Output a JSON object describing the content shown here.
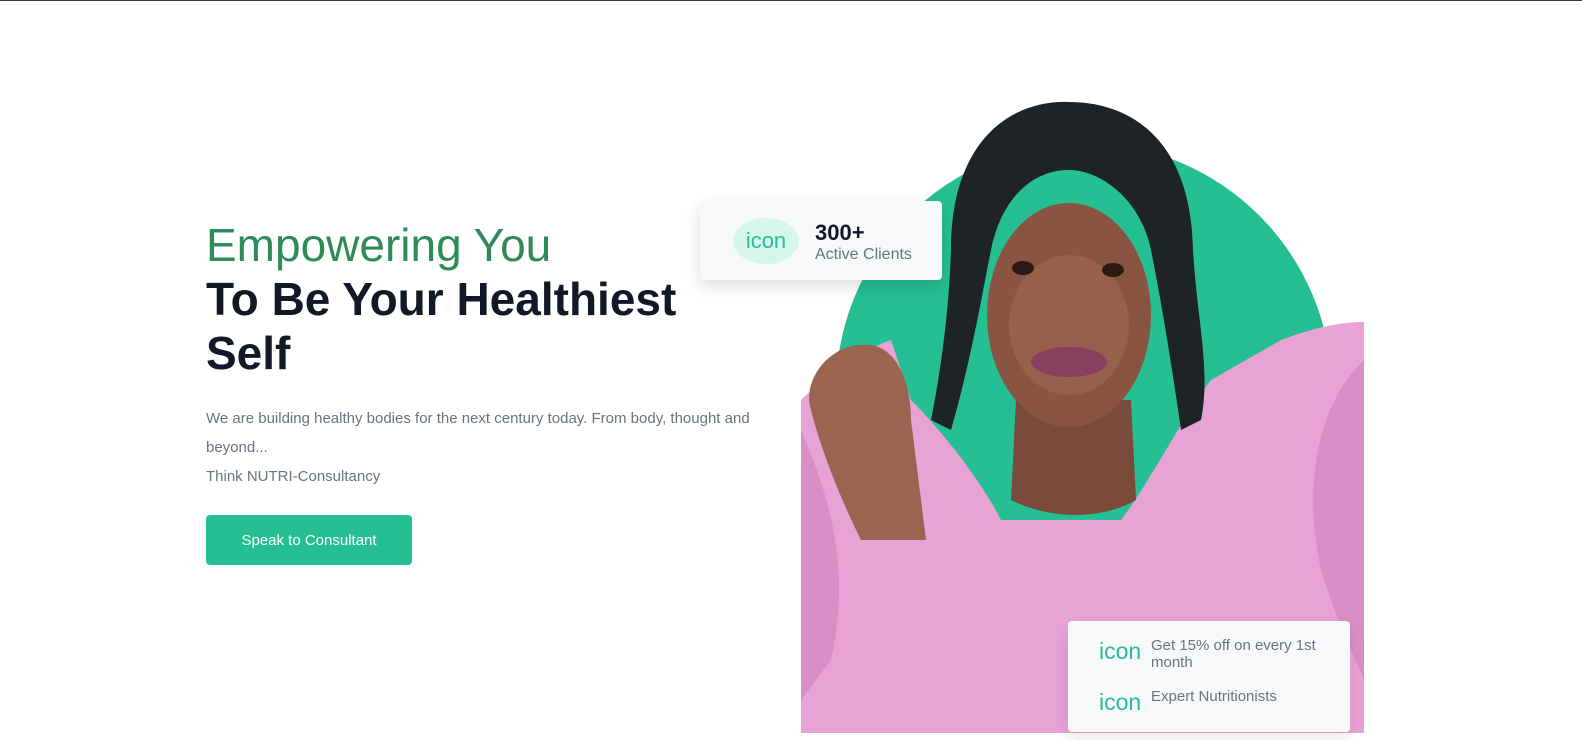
{
  "hero": {
    "headline_accent": "Empowering You",
    "headline_main": "To Be Your Healthiest Self",
    "description_line1": "We are building healthy bodies for the next century today. From body, thought and beyond...",
    "description_line2": "Think NUTRI-Consultancy",
    "cta_label": "Speak to Consultant"
  },
  "stats_card": {
    "icon_text": "icon",
    "number": "300+",
    "label": "Active Clients"
  },
  "perks_card": {
    "items": [
      {
        "icon_text": "icon",
        "text": "Get 15% off on every 1st month"
      },
      {
        "icon_text": "icon",
        "text": "Expert Nutritionists"
      }
    ]
  },
  "colors": {
    "accent_green": "#25bf93",
    "headline_green": "#2e8b57",
    "dark_text": "#111827",
    "muted_text": "#6b7280"
  }
}
